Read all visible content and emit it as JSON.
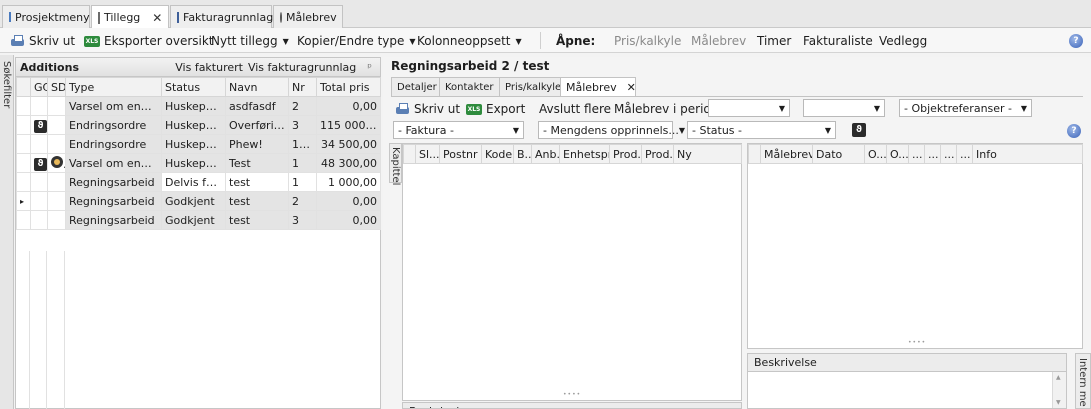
{
  "doc_tabs": [
    {
      "label": "Prosjektmeny",
      "active": false
    },
    {
      "label": "Tillegg",
      "active": true
    },
    {
      "label": "Fakturagrunnlag",
      "active": false
    },
    {
      "label": "Målebrev",
      "active": false
    }
  ],
  "toolbar": {
    "print": "Skriv ut",
    "export": "Eksporter oversikt",
    "new_addition": "Nytt tillegg",
    "copy_change": "Kopier/Endre type",
    "columns": "Kolonneoppsett",
    "open_label": "Åpne:",
    "price_calc": "Pris/kalkyle",
    "measure_letter": "Målebrev",
    "hours": "Timer",
    "invoice_list": "Fakturaliste",
    "attachment": "Vedlegg"
  },
  "sidebar": {
    "label": "Søkefilter"
  },
  "additions": {
    "title": "Additions",
    "show_invoiced": "Vis fakturert",
    "show_basis": "Vis fakturagrunnlag",
    "pin": "ᵖ",
    "columns": [
      "",
      "GC",
      "SD",
      "Type",
      "Status",
      "Navn",
      "Nr",
      "Total pris"
    ],
    "rows": [
      {
        "marker": "",
        "gc": "",
        "sd": "",
        "type": "Varsel om endring",
        "status": "Huskepunkt",
        "name": "asdfasdf",
        "nr": "2",
        "total": "0,00"
      },
      {
        "marker": "",
        "gc": "ϑ",
        "sd": "",
        "type": "Endringsordre",
        "status": "Huskepunkt",
        "name": "Overføring...",
        "nr": "3",
        "total": "115 000,..."
      },
      {
        "marker": "",
        "gc": "",
        "sd": "",
        "type": "Endringsordre",
        "status": "Huskepunkt",
        "name": "Phew!",
        "nr": "1-r...",
        "total": "34 500,00"
      },
      {
        "marker": "",
        "gc": "ϑ",
        "sd": "●",
        "type": "Varsel om endring",
        "status": "Huskepunkt",
        "name": "Test",
        "nr": "1",
        "total": "48 300,00"
      },
      {
        "marker": "",
        "gc": "",
        "sd": "",
        "type": "Regningsarbeid",
        "status": "Delvis faktu...",
        "name": "test",
        "nr": "1",
        "total": "1 000,00"
      },
      {
        "marker": "▸",
        "gc": "",
        "sd": "",
        "type": "Regningsarbeid",
        "status": "Godkjent",
        "name": "test",
        "nr": "2",
        "total": "0,00"
      },
      {
        "marker": "",
        "gc": "",
        "sd": "",
        "type": "Regningsarbeid",
        "status": "Godkjent",
        "name": "test",
        "nr": "3",
        "total": "0,00"
      }
    ]
  },
  "detail": {
    "title": "Regningsarbeid 2 / test",
    "tabs": [
      "Detaljer",
      "Kontakter",
      "Pris/kalkyle",
      "Målebrev"
    ],
    "toolbar": {
      "print": "Skriv ut",
      "export": "Export",
      "close_more": "Avslutt flere",
      "period": "Målebrev i periode",
      "object_ref": "- Objektreferanser -"
    },
    "filters": {
      "invoice": "- Faktura -",
      "created": "- Mengdens opprinnels...",
      "status": "- Status -"
    },
    "kapittel": "Kapittel",
    "grid_left_columns": [
      "",
      "Sl...",
      "Postnr",
      "Kode",
      "B...",
      "Anb...",
      "Enhetspris",
      "Prod...",
      "Prod...",
      "Ny"
    ],
    "grid_right_columns": [
      "",
      "Målebrev",
      "Dato",
      "O...",
      "O...",
      "...",
      "...",
      "...",
      "...",
      "Info"
    ],
    "description": "Beskrivelse",
    "internal_note": "Intern me"
  }
}
